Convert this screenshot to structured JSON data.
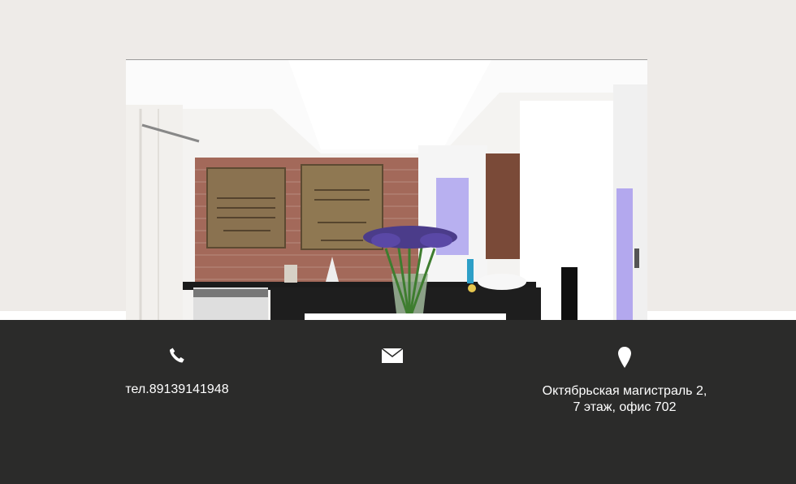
{
  "photo": {
    "alt_name": "kitchen-interior-photo"
  },
  "contacts": {
    "phone": {
      "icon": "phone-icon",
      "text": "тел.89139141948"
    },
    "email": {
      "icon": "envelope-icon"
    },
    "address": {
      "icon": "map-pin-icon",
      "line1": "Октябрьская магистраль 2,",
      "line2": "7 этаж, офис 702"
    }
  },
  "colors": {
    "page_bg": "#eeebe8",
    "footer_bg": "#2b2b2a",
    "footer_text": "#ffffff"
  }
}
